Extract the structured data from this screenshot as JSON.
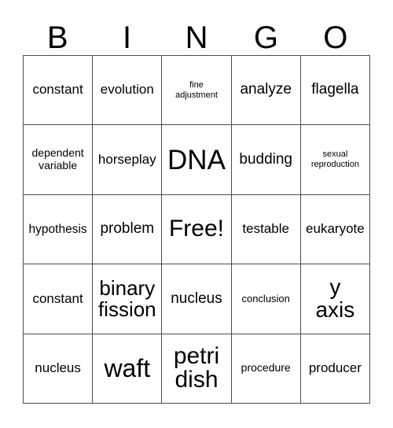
{
  "card": {
    "header_letters": [
      "B",
      "I",
      "N",
      "G",
      "O"
    ],
    "columns": 5,
    "rows": 5,
    "grid_line_color": "#4d4d4d",
    "background_color": "#ffffff",
    "text_color": "#000000",
    "cells": [
      [
        {
          "label": "constant",
          "size": "md2"
        },
        {
          "label": "evolution",
          "size": "md2"
        },
        {
          "label": "fine\nadjustment",
          "size": "xs"
        },
        {
          "label": "analyze",
          "size": "lg"
        },
        {
          "label": "flagella",
          "size": "lg"
        }
      ],
      [
        {
          "label": "dependent\nvariable",
          "size": "sm2"
        },
        {
          "label": "horseplay",
          "size": "md2"
        },
        {
          "label": "DNA",
          "size": "5xl"
        },
        {
          "label": "budding",
          "size": "lg"
        },
        {
          "label": "sexual\nreproduction",
          "size": "xs"
        }
      ],
      [
        {
          "label": "hypothesis",
          "size": "md"
        },
        {
          "label": "problem",
          "size": "lg"
        },
        {
          "label": "Free!",
          "size": "3xl"
        },
        {
          "label": "testable",
          "size": "md2"
        },
        {
          "label": "eukaryote",
          "size": "md2"
        }
      ],
      [
        {
          "label": "constant",
          "size": "md2"
        },
        {
          "label": "binary\nfission",
          "size": "xl"
        },
        {
          "label": "nucleus",
          "size": "lg"
        },
        {
          "label": "conclusion",
          "size": "sm"
        },
        {
          "label": "y\naxis",
          "size": "xxl"
        }
      ],
      [
        {
          "label": "nucleus",
          "size": "md2"
        },
        {
          "label": "waft",
          "size": "4xl"
        },
        {
          "label": "petri\ndish",
          "size": "3xl"
        },
        {
          "label": "procedure",
          "size": "sm2"
        },
        {
          "label": "producer",
          "size": "md2"
        }
      ]
    ]
  }
}
